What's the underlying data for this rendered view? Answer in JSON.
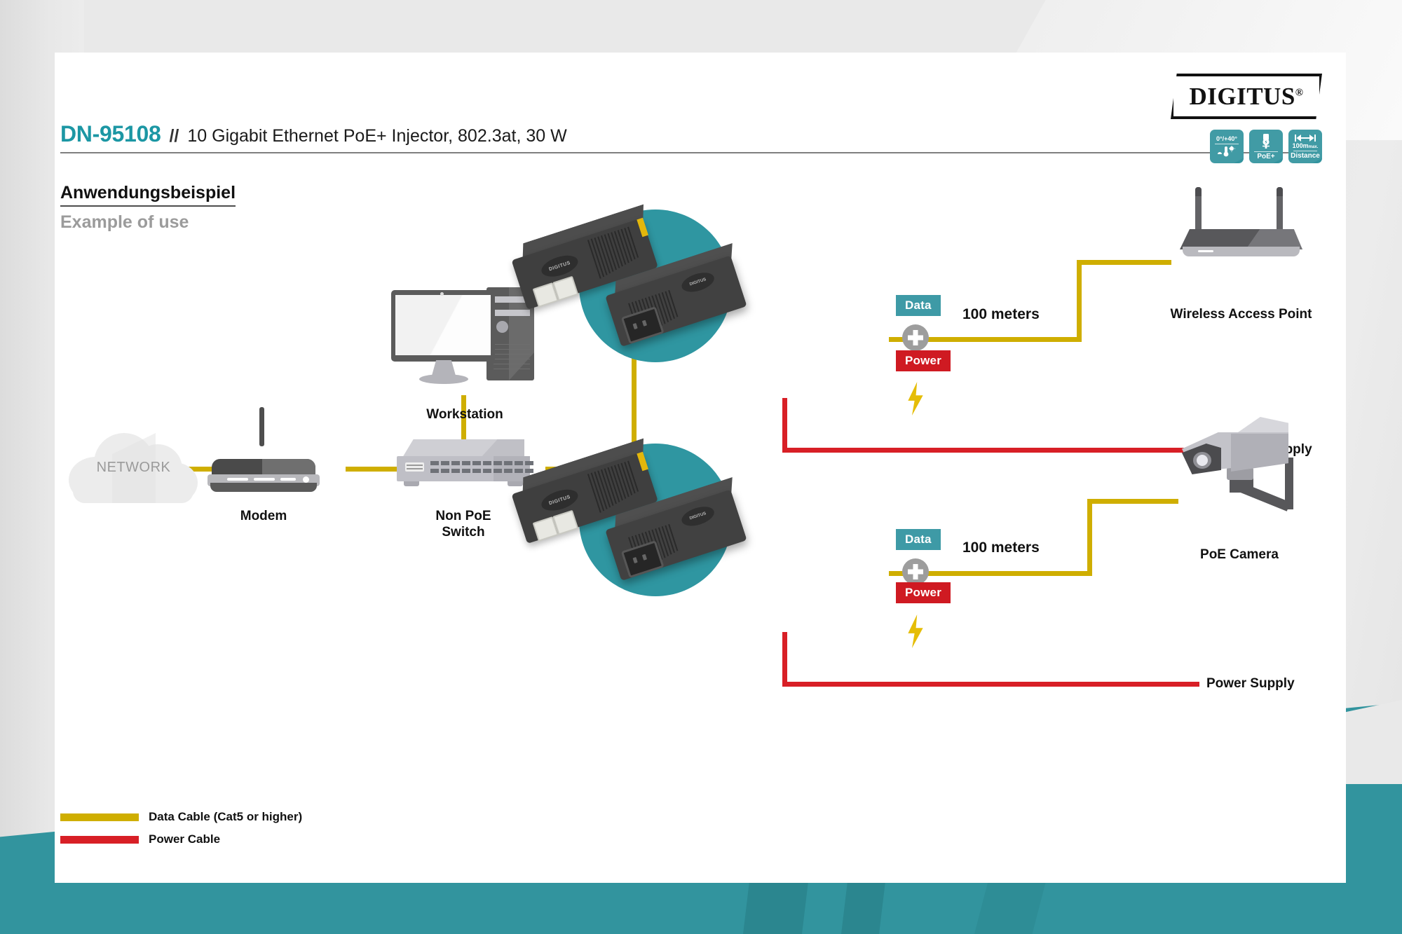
{
  "header": {
    "sku": "DN-95108",
    "separator": "//",
    "subtitle": "10 Gigabit Ethernet PoE+ Injector, 802.3at, 30 W",
    "heading_de": "Anwendungsbeispiel",
    "heading_en": "Example of use",
    "logo_text": "DIGITUS",
    "logo_registered": "®"
  },
  "badges": [
    {
      "name": "temperature-badge",
      "top": "0°/+40°",
      "bottom": ""
    },
    {
      "name": "poe-badge",
      "top": "",
      "bottom": "PoE+"
    },
    {
      "name": "distance-badge",
      "top": "100m",
      "top_small": "max.",
      "bottom": "Distance"
    }
  ],
  "diagram": {
    "cloud_label": "NETWORK",
    "modem_label": "Modem",
    "switch_label": "Non PoE\nSwitch",
    "workstation_label": "Workstation",
    "injector_logo": "DIGITUS",
    "groups": [
      {
        "name": "top-branch",
        "data_chip": "Data",
        "power_chip": "Power",
        "distance": "100 meters",
        "endpoint_label": "Wireless Access Point",
        "power_supply_label": "Power Supply"
      },
      {
        "name": "bottom-branch",
        "data_chip": "Data",
        "power_chip": "Power",
        "distance": "100 meters",
        "endpoint_label": "PoE Camera",
        "power_supply_label": "Power Supply"
      }
    ]
  },
  "legend": [
    {
      "name": "data-cable",
      "label": "Data Cable (Cat5 or higher)",
      "color": "#cfae00"
    },
    {
      "name": "power-cable",
      "label": "Power Cable",
      "color": "#d81f26"
    }
  ],
  "colors": {
    "accent_teal": "#2f96a1",
    "data_yellow": "#cfae00",
    "power_red": "#d81f26",
    "sku_teal": "#1c97a4"
  }
}
